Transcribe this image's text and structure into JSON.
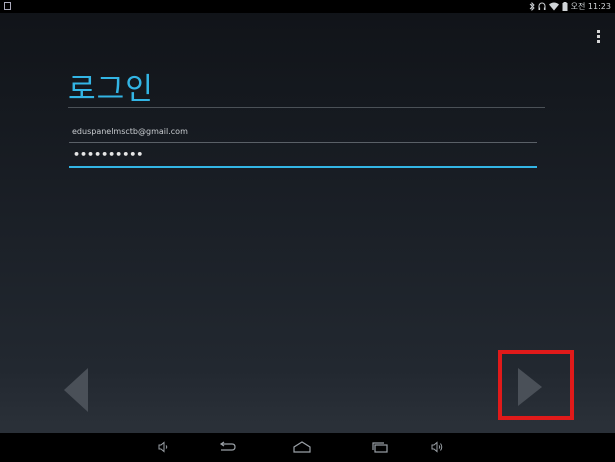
{
  "status_bar": {
    "time": "오전 11:23",
    "icons": [
      "notification-icon",
      "bluetooth-icon",
      "headphones-icon",
      "wifi-icon",
      "battery-icon"
    ]
  },
  "screen": {
    "title": "로그인",
    "email_value": "eduspanelmsctb@gmail.com",
    "password_value": "••••••••••"
  },
  "nav": {
    "prev": "previous-arrow-icon",
    "next": "next-arrow-icon"
  },
  "system_nav": {
    "buttons": [
      "volume-down-icon",
      "back-icon",
      "home-icon",
      "recent-apps-icon",
      "volume-up-icon"
    ]
  },
  "colors": {
    "accent": "#33b5e5",
    "highlight": "#e01a1a"
  }
}
